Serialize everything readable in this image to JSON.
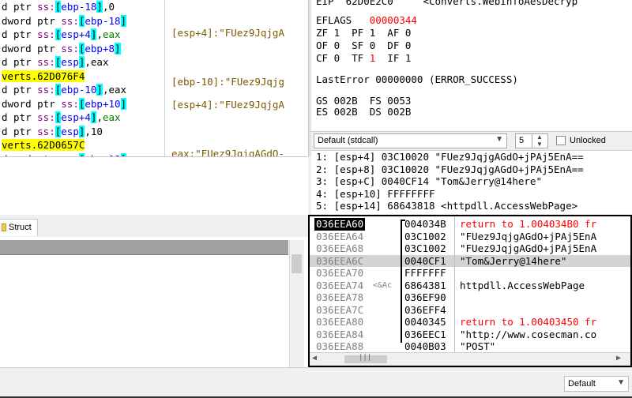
{
  "disasm": [
    [
      {
        "t": "d ptr ",
        "c": ""
      },
      {
        "t": "ss:",
        "c": "seg"
      },
      {
        "t": "[",
        "c": "reg"
      },
      {
        "t": "ebp-18",
        "c": "ptr"
      },
      {
        "t": "]",
        "c": "reg"
      },
      {
        "t": ",0",
        "c": ""
      }
    ],
    [
      {
        "t": "dword ptr ",
        "c": ""
      },
      {
        "t": "ss:",
        "c": "seg"
      },
      {
        "t": "[",
        "c": "reg"
      },
      {
        "t": "ebp-18",
        "c": "ptr"
      },
      {
        "t": "]",
        "c": "reg"
      }
    ],
    [
      {
        "t": "d ptr ",
        "c": ""
      },
      {
        "t": "ss:",
        "c": "seg"
      },
      {
        "t": "[",
        "c": "reg"
      },
      {
        "t": "esp+4",
        "c": "ptr"
      },
      {
        "t": "]",
        "c": "reg"
      },
      {
        "t": ",",
        "c": ""
      },
      {
        "t": "eax",
        "c": "rg2"
      }
    ],
    [
      {
        "t": "dword ptr ",
        "c": ""
      },
      {
        "t": "ss:",
        "c": "seg"
      },
      {
        "t": "[",
        "c": "reg"
      },
      {
        "t": "ebp+8",
        "c": "ptr"
      },
      {
        "t": "]",
        "c": "reg"
      }
    ],
    [
      {
        "t": "d ptr ",
        "c": ""
      },
      {
        "t": "ss:",
        "c": "seg"
      },
      {
        "t": "[",
        "c": "reg"
      },
      {
        "t": "esp",
        "c": "ptr"
      },
      {
        "t": "]",
        "c": "reg"
      },
      {
        "t": ",eax",
        "c": ""
      }
    ],
    [
      {
        "t": "verts.62D076F4",
        "c": "hlbg"
      }
    ],
    [
      {
        "t": "d ptr ",
        "c": ""
      },
      {
        "t": "ss:",
        "c": "seg"
      },
      {
        "t": "[",
        "c": "reg"
      },
      {
        "t": "ebp-10",
        "c": "ptr"
      },
      {
        "t": "]",
        "c": "reg"
      },
      {
        "t": ",eax",
        "c": ""
      }
    ],
    [
      {
        "t": "dword ptr ",
        "c": ""
      },
      {
        "t": "ss:",
        "c": "seg"
      },
      {
        "t": "[",
        "c": "reg"
      },
      {
        "t": "ebp+10",
        "c": "ptr"
      },
      {
        "t": "]",
        "c": "reg"
      }
    ],
    [
      {
        "t": "d ptr ",
        "c": ""
      },
      {
        "t": "ss:",
        "c": "seg"
      },
      {
        "t": "[",
        "c": "reg"
      },
      {
        "t": "esp+4",
        "c": "ptr"
      },
      {
        "t": "]",
        "c": "reg"
      },
      {
        "t": ",",
        "c": ""
      },
      {
        "t": "eax",
        "c": "rg2"
      }
    ],
    [
      {
        "t": "d ptr ",
        "c": ""
      },
      {
        "t": "ss:",
        "c": "seg"
      },
      {
        "t": "[",
        "c": "reg"
      },
      {
        "t": "esp",
        "c": "ptr"
      },
      {
        "t": "]",
        "c": "reg"
      },
      {
        "t": ",10",
        "c": ""
      }
    ],
    [
      {
        "t": "verts.62D0657C",
        "c": "hlbg"
      }
    ],
    [
      {
        "t": "dword ptr ",
        "c": ""
      },
      {
        "t": "ss:",
        "c": "seg"
      },
      {
        "t": "[",
        "c": "reg"
      },
      {
        "t": "ebp-18",
        "c": "ptr"
      },
      {
        "t": "]",
        "c": "reg"
      }
    ],
    [
      {
        "t": "l",
        "c": ""
      }
    ]
  ],
  "comments": [
    "[esp+4]:\"FUez9JqjgA",
    "[ebp-10]:\"FUez9Jqjg",
    "[esp+4]:\"FUez9JqjgA",
    "eax:\"FUez9JqjgAGdO-"
  ],
  "registers": {
    "eip_line": "EIP  62D0E2C0     <Converts.WebInfoAesDecryp",
    "eflags_label": "EFLAGS",
    "eflags_value": "00000344",
    "flags_row1": "ZF 1  PF 1  AF 0",
    "flags_row2": "OF 0  SF 0  DF 0",
    "flags_row3a": "CF 0  TF ",
    "flags_row3b": "1",
    "flags_row3c": "  IF 1",
    "lasterror": "LastError 00000000 (ERROR_SUCCESS)",
    "seg_row1": "GS 002B  FS 0053",
    "seg_row2": "ES 002B  DS 002B"
  },
  "callbar": {
    "convention": "Default (stdcall)",
    "arg_count": "5",
    "unlocked_label": "Unlocked",
    "unlocked_checked": false
  },
  "args": [
    "1: [esp+4] 03C10020 \"FUez9JqjgAGdO+jPAj5EnA==",
    "2: [esp+8] 03C10020 \"FUez9JqjgAGdO+jPAj5EnA==",
    "3: [esp+C] 0040CF14 \"Tom&Jerry@14here\"",
    "4: [esp+10] FFFFFFFF",
    "5: [esp+14] 68643818 <httpdll.AccessWebPage>"
  ],
  "tabs": {
    "struct_label": "Struct"
  },
  "stack": [
    {
      "addr": "036EEA60",
      "cmt": "",
      "val": "004034B",
      "sc": "return to 1.004034B0 fr",
      "ret": true,
      "cur": true,
      "sel": false
    },
    {
      "addr": "036EEA64",
      "cmt": "",
      "val": "03C1002",
      "sc": "\"FUez9JqjgAGdO+jPAj5EnA",
      "ret": false,
      "cur": false,
      "sel": false
    },
    {
      "addr": "036EEA68",
      "cmt": "",
      "val": "03C1002",
      "sc": "\"FUez9JqjgAGdO+jPAj5EnA",
      "ret": false,
      "cur": false,
      "sel": false
    },
    {
      "addr": "036EEA6C",
      "cmt": "",
      "val": "0040CF1",
      "sc": "\"Tom&Jerry@14here\"",
      "ret": false,
      "cur": false,
      "sel": true
    },
    {
      "addr": "036EEA70",
      "cmt": "",
      "val": "FFFFFFF",
      "sc": "",
      "ret": false,
      "cur": false,
      "sel": false
    },
    {
      "addr": "036EEA74",
      "cmt": "<&Ac",
      "val": "6864381",
      "sc": "httpdll.AccessWebPage",
      "ret": false,
      "cur": false,
      "sel": false
    },
    {
      "addr": "036EEA78",
      "cmt": "",
      "val": "036EF90",
      "sc": "",
      "ret": false,
      "cur": false,
      "sel": false
    },
    {
      "addr": "036EEA7C",
      "cmt": "",
      "val": "036EFF4",
      "sc": "",
      "ret": false,
      "cur": false,
      "sel": false
    },
    {
      "addr": "036EEA80",
      "cmt": "",
      "val": "0040345",
      "sc": "return to 1.00403450 fr",
      "ret": true,
      "cur": false,
      "sel": false
    },
    {
      "addr": "036EEA84",
      "cmt": "",
      "val": "036EEC1",
      "sc": "\"http://www.cosecman.co",
      "ret": false,
      "cur": false,
      "sel": false
    },
    {
      "addr": "036EEA88",
      "cmt": "",
      "val": "0040B03",
      "sc": "\"POST\"",
      "ret": false,
      "cur": false,
      "sel": false
    }
  ],
  "status": {
    "select_value": "Default"
  },
  "colors": {
    "highlight": "#ffff00",
    "register_bg": "#00ffff",
    "return_red": "#ff0000",
    "modified_flag": "#ff0000"
  }
}
